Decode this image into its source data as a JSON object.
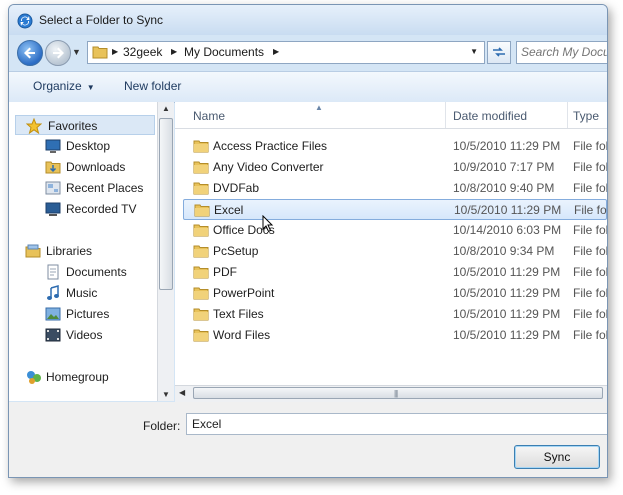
{
  "window": {
    "title": "Select a Folder to Sync"
  },
  "address": {
    "crumbs": [
      "32geek",
      "My Documents"
    ],
    "search_placeholder": "Search My Documents"
  },
  "toolbar": {
    "organize": "Organize",
    "new_folder": "New folder"
  },
  "nav": {
    "favorites": "Favorites",
    "desktop": "Desktop",
    "downloads": "Downloads",
    "recent_places": "Recent Places",
    "recorded_tv": "Recorded TV",
    "libraries": "Libraries",
    "documents": "Documents",
    "music": "Music",
    "pictures": "Pictures",
    "videos": "Videos",
    "homegroup": "Homegroup"
  },
  "columns": {
    "name": "Name",
    "date": "Date modified",
    "type": "Type"
  },
  "files": [
    {
      "name": "Access Practice Files",
      "date": "10/5/2010 11:29 PM",
      "type": "File folder"
    },
    {
      "name": "Any Video Converter",
      "date": "10/9/2010 7:17 PM",
      "type": "File folder"
    },
    {
      "name": "DVDFab",
      "date": "10/8/2010 9:40 PM",
      "type": "File folder"
    },
    {
      "name": "Excel",
      "date": "10/5/2010 11:29 PM",
      "type": "File folder",
      "selected": true
    },
    {
      "name": "Office Docs",
      "date": "10/14/2010 6:03 PM",
      "type": "File folder"
    },
    {
      "name": "PcSetup",
      "date": "10/8/2010 9:34 PM",
      "type": "File folder"
    },
    {
      "name": "PDF",
      "date": "10/5/2010 11:29 PM",
      "type": "File folder"
    },
    {
      "name": "PowerPoint",
      "date": "10/5/2010 11:29 PM",
      "type": "File folder"
    },
    {
      "name": "Text Files",
      "date": "10/5/2010 11:29 PM",
      "type": "File folder"
    },
    {
      "name": "Word Files",
      "date": "10/5/2010 11:29 PM",
      "type": "File folder"
    }
  ],
  "footer": {
    "folder_label": "Folder:",
    "folder_value": "Excel",
    "sync_label": "Sync"
  },
  "colors": {
    "selection": "#d6e7fb",
    "title_bg": "#d4e5f5",
    "folder_icon": "#e8c25a"
  }
}
